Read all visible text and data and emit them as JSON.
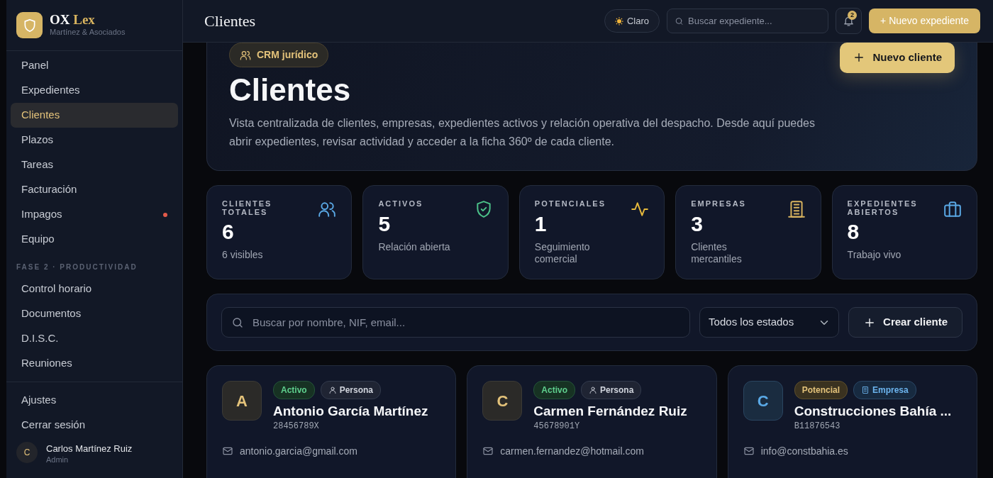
{
  "brand": {
    "name": "OX",
    "accent": "Lex",
    "subtitle": "Martínez & Asociados"
  },
  "sidebar": {
    "items": [
      {
        "label": "Panel",
        "selected": false,
        "alert": false
      },
      {
        "label": "Expedientes",
        "selected": false,
        "alert": false
      },
      {
        "label": "Clientes",
        "selected": true,
        "alert": false
      },
      {
        "label": "Plazos",
        "selected": false,
        "alert": false
      },
      {
        "label": "Tareas",
        "selected": false,
        "alert": false
      },
      {
        "label": "Facturación",
        "selected": false,
        "alert": false
      },
      {
        "label": "Impagos",
        "selected": false,
        "alert": true
      },
      {
        "label": "Equipo",
        "selected": false,
        "alert": false
      }
    ],
    "section_label": "FASE 2 · PRODUCTIVIDAD",
    "section_items": [
      {
        "label": "Control horario",
        "selected": false
      },
      {
        "label": "Documentos",
        "selected": false
      },
      {
        "label": "D.I.S.C.",
        "selected": false
      },
      {
        "label": "Reuniones",
        "selected": false
      }
    ],
    "footer_items": [
      {
        "label": "Ajustes"
      },
      {
        "label": "Cerrar sesión"
      }
    ],
    "user": {
      "initial": "C",
      "name": "Carlos Martínez Ruiz",
      "role": "Admin"
    }
  },
  "topbar": {
    "title": "Clientes",
    "theme_button": "Claro",
    "search": {
      "placeholder": "Buscar expediente..."
    },
    "notifications": "2",
    "new_button": "+ Nuevo expediente"
  },
  "hero": {
    "tag": "CRM jurídico",
    "title": "Clientes",
    "description": "Vista centralizada de clientes, empresas, expedientes activos y relación operativa del despacho. Desde aquí puedes abrir expedientes, revisar actividad y acceder a la ficha 360º de cada cliente.",
    "button": "Nuevo cliente"
  },
  "stats": [
    {
      "label": "CLIENTES TOTALES",
      "value": "6",
      "note": "6 visibles"
    },
    {
      "label": "ACTIVOS",
      "value": "5",
      "note": "Relación abierta"
    },
    {
      "label": "POTENCIALES",
      "value": "1",
      "note": "Seguimiento comercial"
    },
    {
      "label": "EMPRESAS",
      "value": "3",
      "note": "Clientes mercantiles"
    },
    {
      "label": "EXPEDIENTES ABIERTOS",
      "value": "8",
      "note": "Trabajo vivo"
    }
  ],
  "filters": {
    "search": {
      "placeholder": "Buscar por nombre, NIF, email..."
    },
    "status_select": "Todos los estados",
    "create_button": "Crear cliente"
  },
  "clients": [
    {
      "initial": "A",
      "status": {
        "label": "Activo",
        "kind": "active"
      },
      "type": {
        "label": "Persona",
        "kind": "person"
      },
      "name": "Antonio García Martínez",
      "nif": "28456789X",
      "email": "antonio.garcia@gmail.com"
    },
    {
      "initial": "C",
      "status": {
        "label": "Activo",
        "kind": "active"
      },
      "type": {
        "label": "Persona",
        "kind": "person"
      },
      "name": "Carmen Fernández Ruiz",
      "nif": "45678901Y",
      "email": "carmen.fernandez@hotmail.com"
    },
    {
      "initial": "C",
      "status": {
        "label": "Potencial",
        "kind": "potential"
      },
      "type": {
        "label": "Empresa",
        "kind": "company"
      },
      "name": "Construcciones Bahía ...",
      "nif": "B11876543",
      "email": "info@constbahia.es"
    }
  ]
}
